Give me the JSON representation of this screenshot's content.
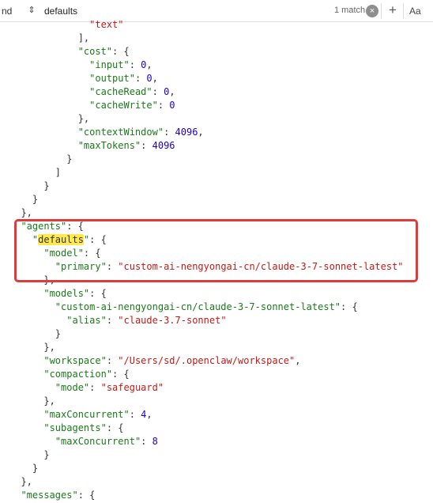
{
  "find_bar": {
    "mode_label": "nd",
    "search_value": "defaults",
    "match_count": "1 match",
    "clear_symbol": "×",
    "add_symbol": "+",
    "case_label": "Aa"
  },
  "code_lines": [
    {
      "indent": 14,
      "tokens": [
        {
          "t": "s",
          "v": "\"text\""
        }
      ]
    },
    {
      "indent": 12,
      "tokens": [
        {
          "t": "p",
          "v": "],"
        }
      ]
    },
    {
      "indent": 12,
      "tokens": [
        {
          "t": "k",
          "v": "\"cost\""
        },
        {
          "t": "p",
          "v": ": {"
        }
      ]
    },
    {
      "indent": 14,
      "tokens": [
        {
          "t": "k",
          "v": "\"input\""
        },
        {
          "t": "p",
          "v": ": "
        },
        {
          "t": "n",
          "v": "0"
        },
        {
          "t": "p",
          "v": ","
        }
      ]
    },
    {
      "indent": 14,
      "tokens": [
        {
          "t": "k",
          "v": "\"output\""
        },
        {
          "t": "p",
          "v": ": "
        },
        {
          "t": "n",
          "v": "0"
        },
        {
          "t": "p",
          "v": ","
        }
      ]
    },
    {
      "indent": 14,
      "tokens": [
        {
          "t": "k",
          "v": "\"cacheRead\""
        },
        {
          "t": "p",
          "v": ": "
        },
        {
          "t": "n",
          "v": "0"
        },
        {
          "t": "p",
          "v": ","
        }
      ]
    },
    {
      "indent": 14,
      "tokens": [
        {
          "t": "k",
          "v": "\"cacheWrite\""
        },
        {
          "t": "p",
          "v": ": "
        },
        {
          "t": "n",
          "v": "0"
        }
      ]
    },
    {
      "indent": 12,
      "tokens": [
        {
          "t": "p",
          "v": "},"
        }
      ]
    },
    {
      "indent": 12,
      "tokens": [
        {
          "t": "k",
          "v": "\"contextWindow\""
        },
        {
          "t": "p",
          "v": ": "
        },
        {
          "t": "n",
          "v": "4096"
        },
        {
          "t": "p",
          "v": ","
        }
      ]
    },
    {
      "indent": 12,
      "tokens": [
        {
          "t": "k",
          "v": "\"maxTokens\""
        },
        {
          "t": "p",
          "v": ": "
        },
        {
          "t": "n",
          "v": "4096"
        }
      ]
    },
    {
      "indent": 10,
      "tokens": [
        {
          "t": "p",
          "v": "}"
        }
      ]
    },
    {
      "indent": 8,
      "tokens": [
        {
          "t": "p",
          "v": "]"
        }
      ]
    },
    {
      "indent": 6,
      "tokens": [
        {
          "t": "p",
          "v": "}"
        }
      ]
    },
    {
      "indent": 4,
      "tokens": [
        {
          "t": "p",
          "v": "}"
        }
      ]
    },
    {
      "indent": 2,
      "tokens": [
        {
          "t": "p",
          "v": "},"
        }
      ]
    },
    {
      "indent": 2,
      "tokens": [
        {
          "t": "k",
          "v": "\"agents\""
        },
        {
          "t": "p",
          "v": ": {"
        }
      ]
    },
    {
      "indent": 4,
      "tokens": [
        {
          "t": "k",
          "v": "\""
        },
        {
          "t": "hl",
          "v": "defaults"
        },
        {
          "t": "k",
          "v": "\""
        },
        {
          "t": "p",
          "v": ": {"
        }
      ]
    },
    {
      "indent": 6,
      "tokens": [
        {
          "t": "k",
          "v": "\"model\""
        },
        {
          "t": "p",
          "v": ": {"
        }
      ]
    },
    {
      "indent": 8,
      "tokens": [
        {
          "t": "k",
          "v": "\"primary\""
        },
        {
          "t": "p",
          "v": ": "
        },
        {
          "t": "s",
          "v": "\"custom-ai-nengyongai-cn/claude-3-7-sonnet-latest\""
        }
      ]
    },
    {
      "indent": 6,
      "tokens": [
        {
          "t": "p",
          "v": "},"
        }
      ]
    },
    {
      "indent": 6,
      "tokens": [
        {
          "t": "k",
          "v": "\"models\""
        },
        {
          "t": "p",
          "v": ": {"
        }
      ]
    },
    {
      "indent": 8,
      "tokens": [
        {
          "t": "k",
          "v": "\"custom-ai-nengyongai-cn/claude-3-7-sonnet-latest\""
        },
        {
          "t": "p",
          "v": ": {"
        }
      ]
    },
    {
      "indent": 10,
      "tokens": [
        {
          "t": "k",
          "v": "\"alias\""
        },
        {
          "t": "p",
          "v": ": "
        },
        {
          "t": "s",
          "v": "\"claude-3.7-sonnet\""
        }
      ]
    },
    {
      "indent": 8,
      "tokens": [
        {
          "t": "p",
          "v": "}"
        }
      ]
    },
    {
      "indent": 6,
      "tokens": [
        {
          "t": "p",
          "v": "},"
        }
      ]
    },
    {
      "indent": 6,
      "tokens": [
        {
          "t": "k",
          "v": "\"workspace\""
        },
        {
          "t": "p",
          "v": ": "
        },
        {
          "t": "s",
          "v": "\"/Users/sd/.openclaw/workspace\""
        },
        {
          "t": "p",
          "v": ","
        }
      ]
    },
    {
      "indent": 6,
      "tokens": [
        {
          "t": "k",
          "v": "\"compaction\""
        },
        {
          "t": "p",
          "v": ": {"
        }
      ]
    },
    {
      "indent": 8,
      "tokens": [
        {
          "t": "k",
          "v": "\"mode\""
        },
        {
          "t": "p",
          "v": ": "
        },
        {
          "t": "s",
          "v": "\"safeguard\""
        }
      ]
    },
    {
      "indent": 6,
      "tokens": [
        {
          "t": "p",
          "v": "},"
        }
      ]
    },
    {
      "indent": 6,
      "tokens": [
        {
          "t": "k",
          "v": "\"maxConcurrent\""
        },
        {
          "t": "p",
          "v": ": "
        },
        {
          "t": "n",
          "v": "4"
        },
        {
          "t": "p",
          "v": ","
        }
      ]
    },
    {
      "indent": 6,
      "tokens": [
        {
          "t": "k",
          "v": "\"subagents\""
        },
        {
          "t": "p",
          "v": ": {"
        }
      ]
    },
    {
      "indent": 8,
      "tokens": [
        {
          "t": "k",
          "v": "\"maxConcurrent\""
        },
        {
          "t": "p",
          "v": ": "
        },
        {
          "t": "n",
          "v": "8"
        }
      ]
    },
    {
      "indent": 6,
      "tokens": [
        {
          "t": "p",
          "v": "}"
        }
      ]
    },
    {
      "indent": 4,
      "tokens": [
        {
          "t": "p",
          "v": "}"
        }
      ]
    },
    {
      "indent": 2,
      "tokens": [
        {
          "t": "p",
          "v": "},"
        }
      ]
    },
    {
      "indent": 2,
      "tokens": [
        {
          "t": "k",
          "v": "\"messages\""
        },
        {
          "t": "p",
          "v": ": {"
        }
      ]
    }
  ],
  "colors": {
    "key": "#1a7a1a",
    "string": "#c41a16",
    "number": "#1c00cf",
    "match_highlight": "#ffe94d",
    "annotation_box": "#e03b3b"
  }
}
